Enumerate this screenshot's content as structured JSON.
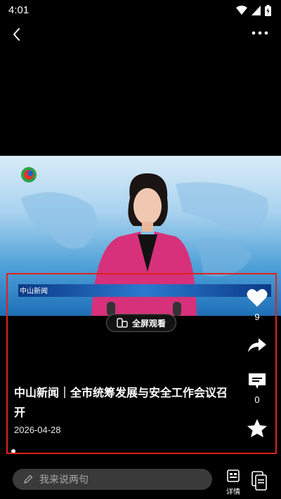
{
  "status_bar": {
    "time": "4:01"
  },
  "video": {
    "channel_logo_text": "中山新闻",
    "fullscreen_label": "全屏观看"
  },
  "actions": {
    "like_count": "9",
    "comment_count": "0"
  },
  "article": {
    "title": "中山新闻｜全市统筹发展与安全工作会议召开",
    "date": "2026-04-28"
  },
  "bottom_bar": {
    "comment_placeholder": "我来说两句",
    "detail_label": "详情"
  },
  "colors": {
    "highlight_border": "#e0221b",
    "background": "#000000"
  }
}
